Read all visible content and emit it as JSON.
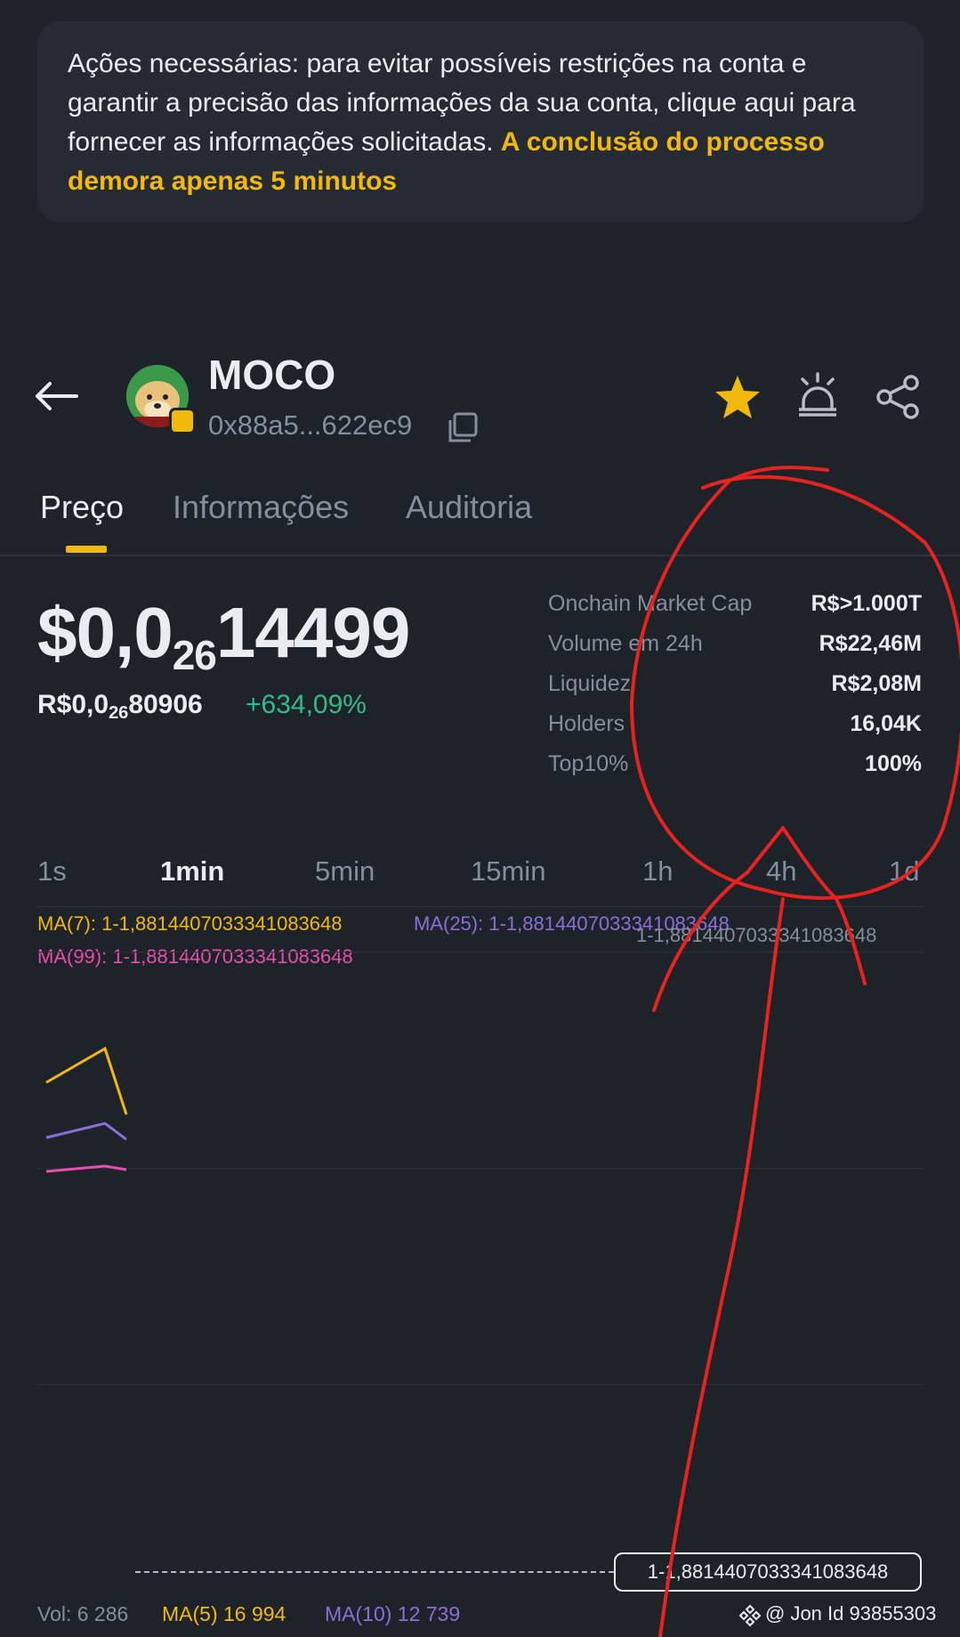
{
  "banner": {
    "text": "Ações necessárias: para evitar possíveis restrições na conta e garantir a precisão das informações da sua conta, clique aqui para fornecer as informações solicitadas.",
    "highlight": "A conclusão do processo demora apenas 5 minutos"
  },
  "token": {
    "name": "MOCO",
    "address": "0x88a5...622ec9"
  },
  "tabs": [
    {
      "label": "Preço",
      "active": true
    },
    {
      "label": "Informações",
      "active": false
    },
    {
      "label": "Auditoria",
      "active": false
    }
  ],
  "price": {
    "usd_prefix": "$0,0",
    "usd_sub": "26",
    "usd_digits": "14499",
    "brl_prefix": "R$0,0",
    "brl_sub": "26",
    "brl_digits": "80906",
    "change": "+634,09%"
  },
  "stats": [
    {
      "label": "Onchain Market Cap",
      "value": "R$>1.000T"
    },
    {
      "label": "Volume em 24h",
      "value": "R$22,46M"
    },
    {
      "label": "Liquidez",
      "value": "R$2,08M"
    },
    {
      "label": "Holders",
      "value": "16,04K"
    },
    {
      "label": "Top10%",
      "value": "100%"
    }
  ],
  "intervals": [
    {
      "label": "1s",
      "active": false
    },
    {
      "label": "1min",
      "active": true
    },
    {
      "label": "5min",
      "active": false
    },
    {
      "label": "15min",
      "active": false
    },
    {
      "label": "1h",
      "active": false
    },
    {
      "label": "4h",
      "active": false
    },
    {
      "label": "1d",
      "active": false
    }
  ],
  "chart": {
    "ma7": "MA(7): 1-1,8814407033341083648",
    "ma25": "MA(25): 1-1,8814407033341083648",
    "ma99": "MA(99): 1-1,8814407033341083648",
    "axis_label": "1-1,8814407033341083648",
    "current_price_tag": "1-1,8814407033341083648"
  },
  "volume": {
    "vol": "Vol: 6 286",
    "ma5": "MA(5) 16 994",
    "ma10": "MA(10) 12 739"
  },
  "watermark": "@ Jon Id 93855303",
  "colors": {
    "accent": "#f0b90b",
    "up": "#2ebd85",
    "ma25": "#8a6fd6",
    "ma99": "#e74fae",
    "annotation": "#e8231f"
  }
}
